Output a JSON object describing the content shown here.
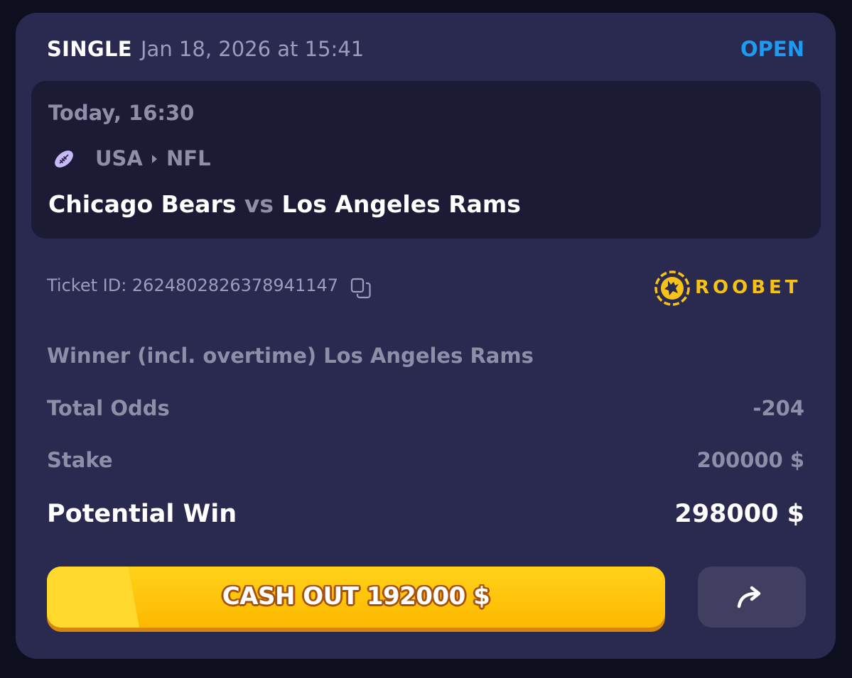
{
  "bet": {
    "type": "SINGLE",
    "placed_at": "Jan 18, 2026 at 15:41",
    "status": "OPEN",
    "status_color": "#1e9bf0"
  },
  "event": {
    "time": "Today, 16:30",
    "sport_icon": "american-football-icon",
    "country": "USA",
    "league": "NFL",
    "home_team": "Chicago Bears",
    "vs": "vs",
    "away_team": "Los Angeles Rams"
  },
  "ticket": {
    "label": "Ticket ID: ",
    "id": "262480282637894​1147",
    "copy_icon": "copy-icon"
  },
  "brand": {
    "name": "ROOBET",
    "color": "#f6c218"
  },
  "selection": "Winner (incl. overtime) Los Angeles Rams",
  "summary": {
    "odds_label": "Total Odds",
    "odds_value": "-204",
    "stake_label": "Stake",
    "stake_value": "200000 $",
    "win_label": "Potential Win",
    "win_value": "298000 $"
  },
  "actions": {
    "cashout_label": "CASH OUT 192000 $",
    "cashout_color": "#ffc20a",
    "share_icon": "share-arrow-icon"
  }
}
